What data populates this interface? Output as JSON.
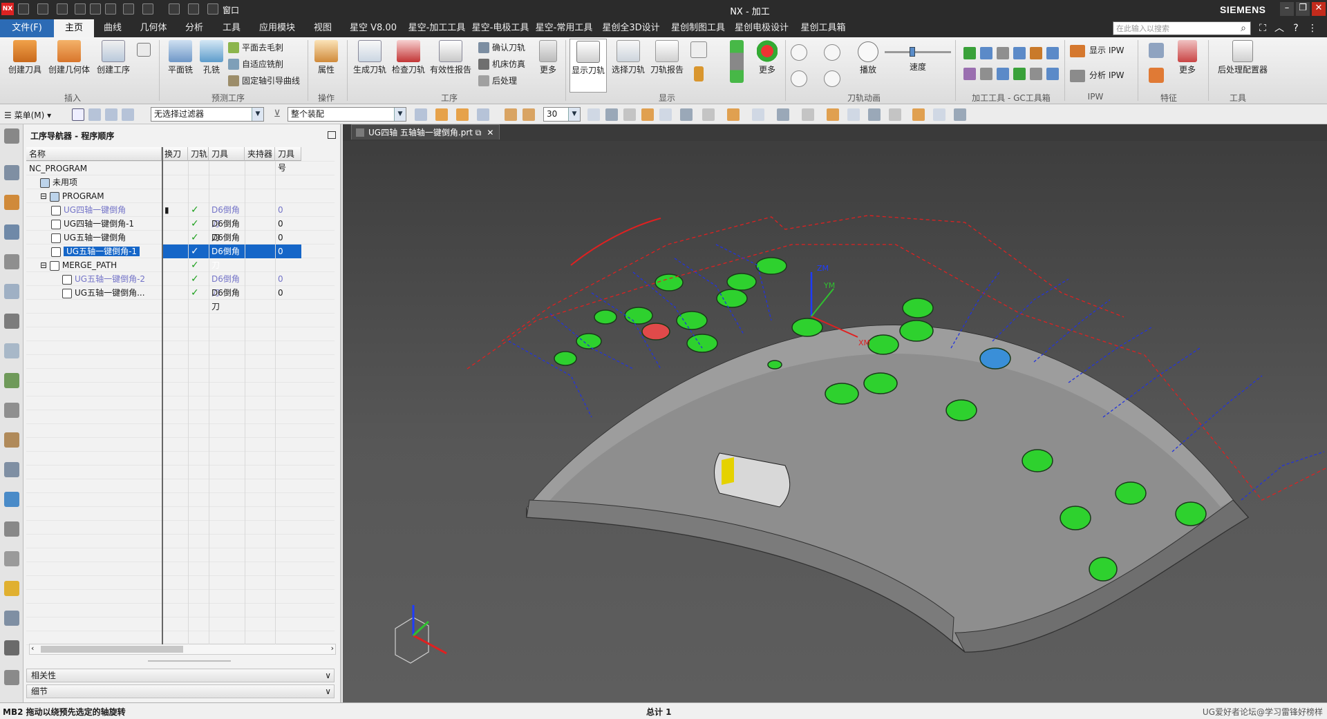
{
  "window": {
    "title": "NX - 加工",
    "brand": "SIEMENS",
    "search_placeholder": "在此输入以搜索"
  },
  "quick_access": {
    "window_menu": "窗口"
  },
  "tabs": [
    "文件(F)",
    "主页",
    "曲线",
    "几何体",
    "分析",
    "工具",
    "应用模块",
    "视图",
    "星空 V8.00",
    "星空-加工工具",
    "星空-电极工具",
    "星空-常用工具",
    "星创全3D设计",
    "星创制图工具",
    "星创电极设计",
    "星创工具箱"
  ],
  "ribbon": {
    "insert": {
      "create_tool": "创建刀具",
      "create_geometry": "创建几何体",
      "create_operation": "创建工序",
      "group": "插入"
    },
    "preset": {
      "face_mill": "平面铣",
      "hole_mill": "孔铣",
      "deburr": "平面去毛刺",
      "adaptive": "自适应铣削",
      "fixed_axis": "固定轴引导曲线",
      "group": "预测工序"
    },
    "ops": {
      "properties": "属性",
      "group": "操作"
    },
    "process": {
      "gen_path": "生成刀轨",
      "check_path": "检查刀轨",
      "validity": "有效性报告",
      "confirm_path": "确认刀轨",
      "machine_sim": "机床仿真",
      "postprocess": "后处理",
      "more": "更多",
      "group": "工序"
    },
    "display": {
      "show_path": "显示刀轨",
      "select_path": "选择刀轨",
      "path_report": "刀轨报告",
      "more": "更多",
      "group": "显示"
    },
    "anim": {
      "play": "播放",
      "speed": "速度",
      "group": "刀轨动画"
    },
    "gc": {
      "group": "加工工具 - GC工具箱"
    },
    "ipw": {
      "show": "显示 IPW",
      "analyze": "分析 IPW",
      "group": "IPW"
    },
    "feature": {
      "more": "更多",
      "group": "特征"
    },
    "tools": {
      "post_config": "后处理配置器",
      "group": "工具"
    }
  },
  "filterbar": {
    "menu": "菜单(M)",
    "filter": "无选择过滤器",
    "scope": "整个装配",
    "value": "30"
  },
  "navigator": {
    "title": "工序导航器 - 程序顺序",
    "columns": [
      "名称",
      "换刀",
      "刀轨",
      "刀具",
      "夹持器",
      "刀具号"
    ],
    "rows": [
      {
        "name": "NC_PROGRAM",
        "toolchg": "",
        "path": "",
        "tool": "",
        "holder": "",
        "num": "",
        "indent": 0,
        "sel": false,
        "grey": false
      },
      {
        "name": "未用项",
        "toolchg": "",
        "path": "",
        "tool": "",
        "holder": "",
        "num": "",
        "indent": 1,
        "sel": false,
        "grey": false
      },
      {
        "name": "PROGRAM",
        "toolchg": "",
        "path": "",
        "tool": "",
        "holder": "",
        "num": "",
        "indent": 1,
        "sel": false,
        "grey": false
      },
      {
        "name": "UG四轴一键倒角",
        "toolchg": "▮",
        "path": "✓",
        "tool": "D6倒角刀",
        "holder": "",
        "num": "0",
        "indent": 2,
        "sel": false,
        "grey": true
      },
      {
        "name": "UG四轴一键倒角-1",
        "toolchg": "",
        "path": "✓",
        "tool": "D6倒角刀",
        "holder": "",
        "num": "0",
        "indent": 2,
        "sel": false,
        "grey": false
      },
      {
        "name": "UG五轴一键倒角",
        "toolchg": "",
        "path": "✓",
        "tool": "D6倒角刀",
        "holder": "",
        "num": "0",
        "indent": 2,
        "sel": false,
        "grey": false
      },
      {
        "name": "UG五轴一键倒角-1",
        "toolchg": "",
        "path": "✓",
        "tool": "D6倒角刀",
        "holder": "",
        "num": "0",
        "indent": 2,
        "sel": true,
        "grey": false
      },
      {
        "name": "MERGE_PATH",
        "toolchg": "",
        "path": "✓",
        "tool": "",
        "holder": "",
        "num": "",
        "indent": 1,
        "sel": false,
        "grey": false
      },
      {
        "name": "UG五轴一键倒角-2",
        "toolchg": "",
        "path": "✓",
        "tool": "D6倒角刀",
        "holder": "",
        "num": "0",
        "indent": 3,
        "sel": false,
        "grey": true
      },
      {
        "name": "UG五轴一键倒角...",
        "toolchg": "",
        "path": "✓",
        "tool": "D6倒角刀",
        "holder": "",
        "num": "0",
        "indent": 3,
        "sel": false,
        "grey": false
      }
    ],
    "sections": [
      "相关性",
      "细节"
    ]
  },
  "viewport": {
    "doc_tab": "UG四轴 五轴轴一键倒角.prt",
    "axis_labels": {
      "z": "ZM",
      "y": "YM",
      "x": "XM"
    }
  },
  "status": {
    "left": "MB2 拖动以绕预先选定的轴旋转",
    "middle": "总计 1",
    "right": "UG爱好者论坛@学习雷锋好榜样"
  },
  "colors": {
    "accent": "#1566c8",
    "file_tab": "#2c6bb5",
    "check": "#1ea01e",
    "hole_green": "#2ed12e",
    "part_grey": "#8c8c8c"
  }
}
